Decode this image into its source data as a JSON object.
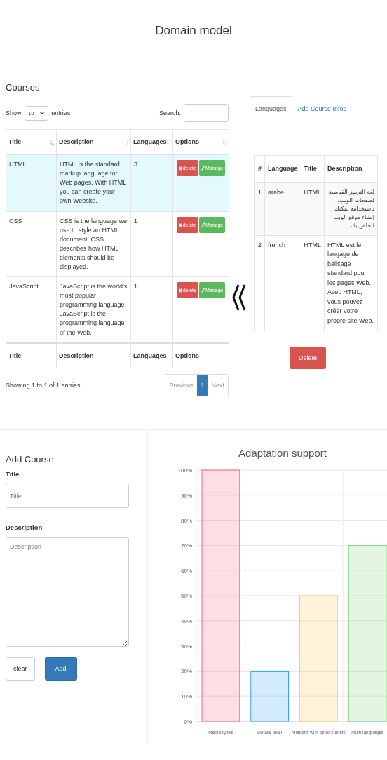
{
  "page_title": "Domain model",
  "courses": {
    "heading": "Courses",
    "show_label": "Show",
    "length_value": "10",
    "entries_label": "entries",
    "search_label": "Search:",
    "columns": [
      {
        "label": "Title",
        "sorted": true
      },
      {
        "label": "Description",
        "sorted": false
      },
      {
        "label": "Languages",
        "sorted": false
      },
      {
        "label": "Options",
        "sorted": false
      }
    ],
    "rows": [
      {
        "title": "HTML",
        "description": "HTML is the standard markup language for Web pages. With HTML you can create your own Website.",
        "languages": "3",
        "selected": true,
        "delete_label": "delete",
        "manage_label": "Manage"
      },
      {
        "title": "CSS",
        "description": "CSS is the language we use to style an HTML document. CSS describes how HTML elements should be displayed.",
        "languages": "1",
        "selected": false,
        "delete_label": "delete",
        "manage_label": "Manage"
      },
      {
        "title": "JavaScript",
        "description": "JavaScript is the world's most popular programming language. JavaScript is the programming language of the Web.",
        "languages": "1",
        "selected": false,
        "delete_label": "delete",
        "manage_label": "Manage"
      }
    ],
    "footer_columns": [
      "Title",
      "Description",
      "Languages",
      "Options"
    ],
    "info": "Showing 1 to 1 of 1 entries",
    "pagination": [
      {
        "label": "Previous",
        "selected": false
      },
      {
        "label": "1",
        "selected": true
      },
      {
        "label": "Next",
        "selected": false
      }
    ]
  },
  "side": {
    "tabs": [
      {
        "label": "Languages",
        "selected": true
      },
      {
        "label": "Add Course Infos",
        "selected": false
      }
    ],
    "columns": [
      "#",
      "Language",
      "Title",
      "Description"
    ],
    "rows": [
      {
        "number": "1",
        "language": "arabe",
        "title": "HTML",
        "description": "لغة الترميز القياسية لصفحات الويب. باستخدامه يمكنك إنشاء موقع الويب الخاص بك",
        "rtl": true
      },
      {
        "number": "2",
        "language": "french",
        "title": "HTML",
        "description": "HTML est le langage de balisage standard pour les pages Web. Avec HTML, vous pouvez créer votre propre site Web.",
        "rtl": false
      }
    ],
    "delete_label": "Delete"
  },
  "add_course": {
    "heading": "Add Course",
    "title_label": "Title",
    "title_placeholder": "Title",
    "description_label": "Description",
    "description_placeholder": "Description",
    "buttons": [
      {
        "label": "clear",
        "kind": "default"
      },
      {
        "label": "Add",
        "kind": "primary"
      }
    ]
  },
  "chart": {
    "chart_data": {
      "type": "bar",
      "title": "Adaptation support",
      "categories": [
        "Media types",
        "Details level",
        "relations with other subjets",
        "multi-languages"
      ],
      "series": [
        {
          "color": "#ff6384",
          "values": [
            100,
            null,
            null,
            null
          ]
        },
        {
          "color": "#36a2eb",
          "values": [
            null,
            20,
            null,
            null
          ]
        },
        {
          "color": "#ffce56",
          "values": [
            null,
            null,
            50,
            null
          ]
        },
        {
          "color": "#7bd67b",
          "values": [
            null,
            null,
            null,
            70
          ]
        }
      ],
      "stacked": true,
      "grid": true,
      "ylim": [
        0,
        100
      ],
      "yticks": [
        {
          "value": 0,
          "label": "0%"
        },
        {
          "value": 10,
          "label": "10%"
        },
        {
          "value": 20,
          "label": "20%"
        },
        {
          "value": 30,
          "label": "30%"
        },
        {
          "value": 40,
          "label": "40%"
        },
        {
          "value": 50,
          "label": "50%"
        },
        {
          "value": 60,
          "label": "60%"
        },
        {
          "value": 70,
          "label": "70%"
        },
        {
          "value": 80,
          "label": "80%"
        },
        {
          "value": 90,
          "label": "90%"
        },
        {
          "value": 100,
          "label": "100%"
        }
      ]
    }
  }
}
